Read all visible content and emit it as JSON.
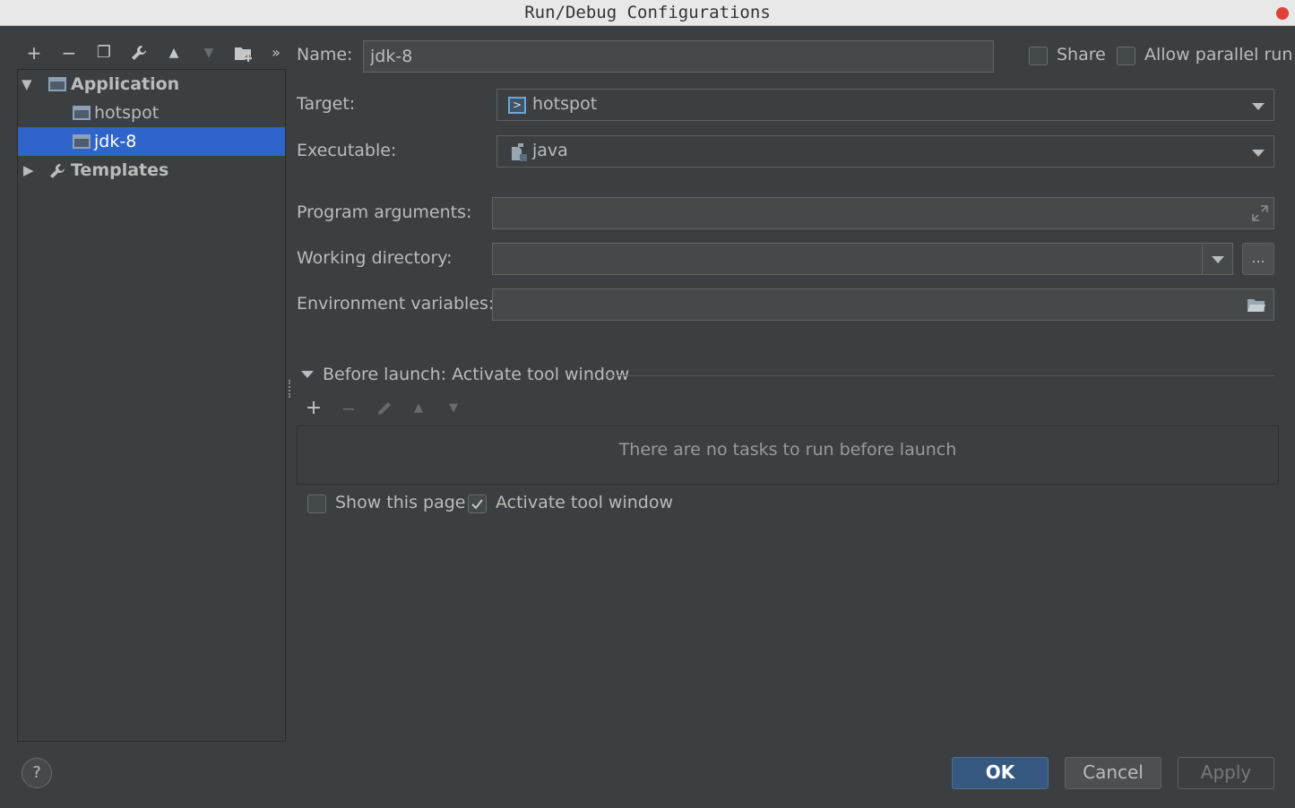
{
  "window": {
    "title": "Run/Debug Configurations"
  },
  "toolbar": {
    "add": "+",
    "remove": "−",
    "copy": "❐",
    "edit_defaults": "🔧",
    "move_up": "▲",
    "move_down": "▼",
    "folder": "📁",
    "more": "»"
  },
  "tree": {
    "application": "Application",
    "hotspot": "hotspot",
    "jdk8": "jdk-8",
    "templates": "Templates"
  },
  "form": {
    "name_label": "Name:",
    "name_value": "jdk-8",
    "share_label": "Share",
    "parallel_label": "Allow parallel run",
    "target_label": "Target:",
    "target_value": "hotspot",
    "executable_label": "Executable:",
    "executable_value": "java",
    "program_args_label": "Program arguments:",
    "working_dir_label": "Working directory:",
    "browse_label": "...",
    "env_label": "Environment variables:"
  },
  "before_launch": {
    "header": "Before launch: Activate tool window",
    "empty_text": "There are no tasks to run before launch",
    "show_page_label": "Show this page",
    "activate_label": "Activate tool window",
    "show_page_checked": false,
    "activate_checked": true
  },
  "buttons": {
    "help": "?",
    "ok": "OK",
    "cancel": "Cancel",
    "apply": "Apply"
  },
  "colors": {
    "background": "#3c3f41",
    "selection": "#2f65ca",
    "ok_button": "#365880"
  }
}
